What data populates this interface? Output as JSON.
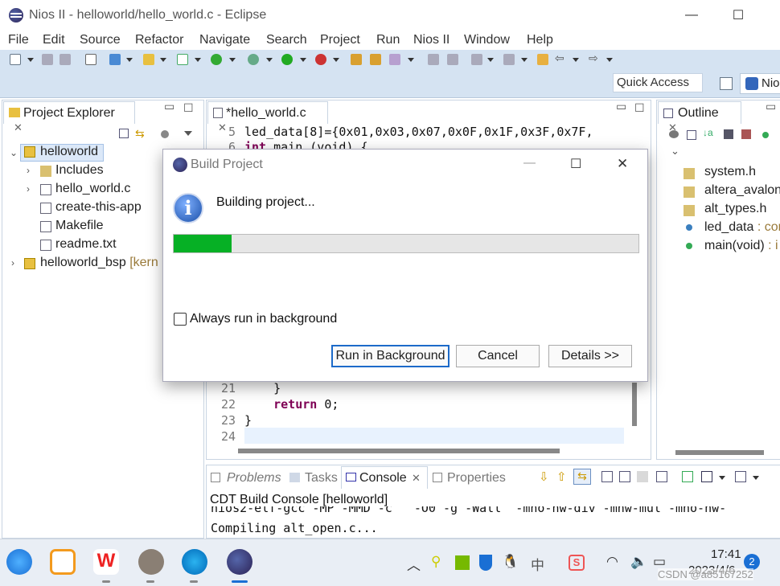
{
  "window": {
    "title": "Nios II - helloworld/hello_world.c - Eclipse",
    "minimize": "—",
    "maximize": "☐"
  },
  "menu": [
    "File",
    "Edit",
    "Source",
    "Refactor",
    "Navigate",
    "Search",
    "Project",
    "Run",
    "Nios II",
    "Window",
    "Help"
  ],
  "toolbar": {
    "quick_access": "Quick Access",
    "perspective": "Nio"
  },
  "project_explorer": {
    "tab": "Project Explorer",
    "items": [
      {
        "label": "helloworld",
        "depth": 0,
        "expanded": true
      },
      {
        "label": "Includes",
        "depth": 1
      },
      {
        "label": "hello_world.c",
        "depth": 1
      },
      {
        "label": "create-this-app",
        "depth": 1
      },
      {
        "label": "Makefile",
        "depth": 1
      },
      {
        "label": "readme.txt",
        "depth": 1
      },
      {
        "label": "helloworld_bsp",
        "suffix": "[kern",
        "depth": 0
      }
    ]
  },
  "editor": {
    "tab": "*hello_world.c",
    "lines": [
      {
        "no": "5",
        "text": "led_data[8]={0x01,0x03,0x07,0x0F,0x1F,0x3F,0x7F,"
      },
      {
        "no": "6",
        "text": "int main (void) {"
      },
      {
        "no": "21",
        "text": "    }"
      },
      {
        "no": "22",
        "text": "    return 0;"
      },
      {
        "no": "23",
        "text": "}"
      },
      {
        "no": "24",
        "text": ""
      }
    ]
  },
  "outline": {
    "tab": "Outline",
    "items": [
      {
        "label": "system.h"
      },
      {
        "label": "altera_avalon"
      },
      {
        "label": "alt_types.h"
      },
      {
        "label": "led_data",
        "suffix": " : cor"
      },
      {
        "label": "main(void)",
        "suffix": " : i"
      }
    ]
  },
  "bottom_panel": {
    "tabs": [
      "Problems",
      "Tasks",
      "Console",
      "Properties"
    ],
    "console_title": "CDT Build Console [helloworld]",
    "lines": [
      "nios2-elf-gcc -MP -MMD -c   -O0 -g -Wall  -mno-hw-div -mnw-mul -mno-hw-",
      "Compiling alt_open.c..."
    ]
  },
  "dialog": {
    "title": "Build Project",
    "message": "Building project...",
    "progress": 0.125,
    "checkbox_label": "Always run in background",
    "checkbox_checked": false,
    "buttons": {
      "run_bg": "Run in Background",
      "cancel": "Cancel",
      "details": "Details >>"
    }
  },
  "taskbar": {
    "time": "17:41",
    "date": "2023/4/6",
    "notifications": "2",
    "ime": "中",
    "watermark": "CSDN @a85167252"
  },
  "colors": {
    "progress": "#06b025",
    "toolbar_bg": "#d5e3f2",
    "keyword": "#7f0055"
  }
}
